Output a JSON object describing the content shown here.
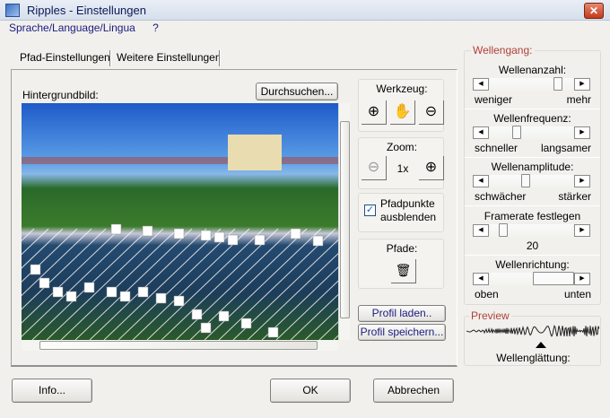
{
  "window": {
    "title": "Ripples - Einstellungen",
    "close": "✕"
  },
  "menu": {
    "language": "Sprache/Language/Lingua",
    "help": "?"
  },
  "tabs": [
    {
      "label": "Pfad-Einstellungen",
      "active": true
    },
    {
      "label": "Weitere Einstellungen",
      "active": false
    }
  ],
  "background": {
    "label": "Hintergrundbild:",
    "browse": "Durchsuchen..."
  },
  "tools": {
    "title": "Werkzeug:",
    "zoom_title": "Zoom:",
    "zoom_level": "1x",
    "hide_points": "Pfadpunkte ausblenden",
    "hide_points_checked": true,
    "paths_title": "Pfade:",
    "load_profile": "Profil laden..",
    "save_profile": "Profil speichern..."
  },
  "waves": {
    "group_title": "Wellengang:",
    "count": {
      "label": "Wellenanzahl:",
      "min": "weniger",
      "max": "mehr",
      "value": 0.85
    },
    "frequency": {
      "label": "Wellenfrequenz:",
      "min": "schneller",
      "max": "langsamer",
      "value": 0.3
    },
    "amplitude": {
      "label": "Wellenamplitude:",
      "min": "schwächer",
      "max": "stärker",
      "value": 0.42
    },
    "framerate": {
      "label": "Framerate festlegen",
      "value_text": "20",
      "value": 0.12
    },
    "direction": {
      "label": "Wellenrichtung:",
      "min": "oben",
      "max": "unten",
      "value": 0.55
    },
    "preview_title": "Preview",
    "smoothing": "Wellenglättung:"
  },
  "footer": {
    "info": "Info...",
    "ok": "OK",
    "cancel": "Abbrechen"
  },
  "colors": {
    "accent_red": "#b0403a",
    "menu_text": "#1a1a80"
  }
}
